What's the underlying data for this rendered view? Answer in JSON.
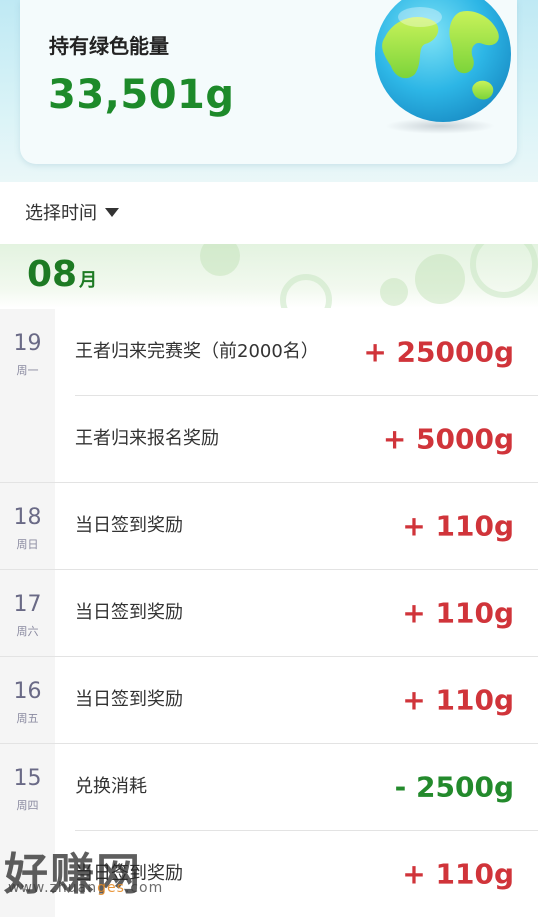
{
  "header": {
    "title": "持有绿色能量",
    "amount": "33,501g"
  },
  "filter": {
    "label": "选择时间"
  },
  "month": {
    "number": "08",
    "unit": "月"
  },
  "days": [
    {
      "day": "19",
      "weekday": "周一",
      "items": [
        {
          "label": "王者归来完赛奖（前2000名）",
          "amount": "+ 25000g",
          "sign": "pos"
        },
        {
          "label": "王者归来报名奖励",
          "amount": "+ 5000g",
          "sign": "pos"
        }
      ]
    },
    {
      "day": "18",
      "weekday": "周日",
      "items": [
        {
          "label": "当日签到奖励",
          "amount": "+ 110g",
          "sign": "pos"
        }
      ]
    },
    {
      "day": "17",
      "weekday": "周六",
      "items": [
        {
          "label": "当日签到奖励",
          "amount": "+ 110g",
          "sign": "pos"
        }
      ]
    },
    {
      "day": "16",
      "weekday": "周五",
      "items": [
        {
          "label": "当日签到奖励",
          "amount": "+ 110g",
          "sign": "pos"
        }
      ]
    },
    {
      "day": "15",
      "weekday": "周四",
      "items": [
        {
          "label": "兑换消耗",
          "amount": "- 2500g",
          "sign": "neg"
        },
        {
          "label": "当日签到奖励",
          "amount": "+ 110g",
          "sign": "pos"
        }
      ]
    }
  ],
  "watermark": {
    "text": "好赚网",
    "url_a": "www.zhuan",
    "url_hl": "ges",
    "url_b": ".com"
  },
  "icons": {
    "globe": "earth-icon",
    "caret": "caret-down-icon"
  },
  "colors": {
    "positive": "#d0343a",
    "negative": "#238a2c",
    "accent": "#1d8a2a"
  }
}
